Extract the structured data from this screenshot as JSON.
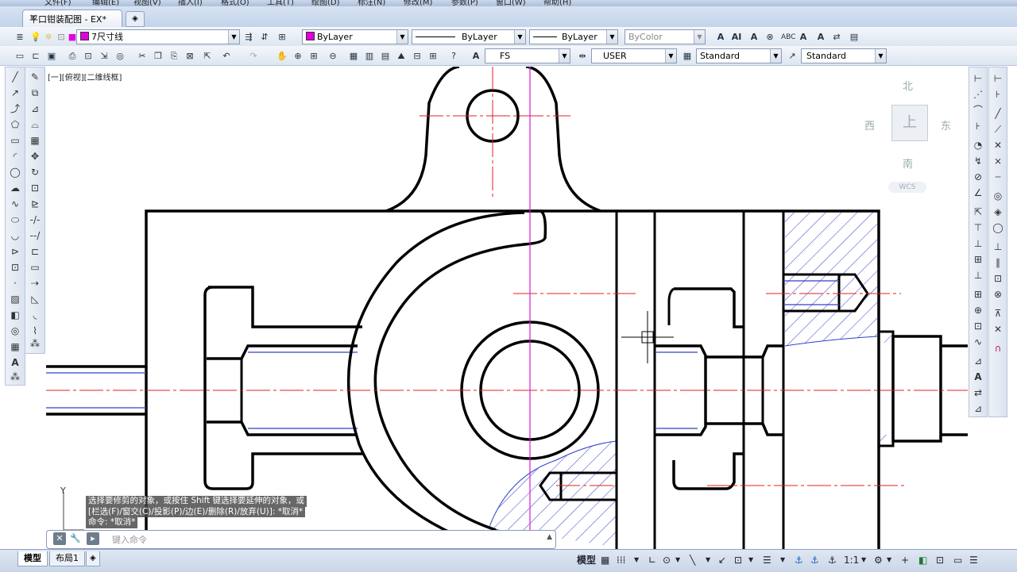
{
  "menubar": {
    "items": [
      "文件(F)",
      "编辑(E)",
      "视图(V)",
      "插入(I)",
      "格式(O)",
      "工具(T)",
      "绘图(D)",
      "标注(N)",
      "修改(M)",
      "参数(P)",
      "窗口(W)",
      "帮助(H)"
    ]
  },
  "tabs": {
    "active": "平口钳装配图 - EX*",
    "close": "×",
    "new_tab": "◈"
  },
  "toolbar1": {
    "layer_combo": "7尺寸线",
    "color_combo": "ByLayer",
    "linetype_combo": "ByLayer",
    "lineweight_combo": "ByLayer",
    "plotstyle_combo": "ByColor",
    "layer_color": "#e000e0"
  },
  "toolbar2": {
    "text_style_combo": "FS",
    "dim_style_combo": "USER",
    "table_style_combo": "Standard",
    "mleader_style_combo": "Standard"
  },
  "viewport": {
    "label": "[一][俯视][二维线框]"
  },
  "viewcube": {
    "north": "北",
    "south": "南",
    "east": "东",
    "west": "西",
    "top": "上",
    "wcs": "WCS"
  },
  "ucs": {
    "y_label": "Y"
  },
  "command": {
    "history": [
      "选择要修剪的对象，或按住 Shift 键选择要延伸的对象，或",
      "[栏选(F)/窗交(C)/投影(P)/边(E)/删除(R)/放弃(U)]: *取消*",
      "命令: *取消*"
    ],
    "placeholder": "键入命令"
  },
  "layout_tabs": [
    "模型",
    "布局1"
  ],
  "statusbar": {
    "model_label": "模型",
    "scale_label": "1:1"
  },
  "colors": {
    "centerline": "#e02020",
    "axis_magenta": "#d020d0",
    "hatch": "#3040c8",
    "outline": "#000000"
  }
}
